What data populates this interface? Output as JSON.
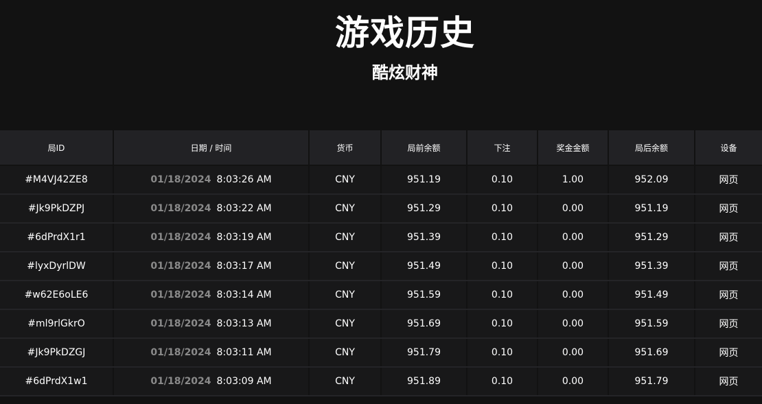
{
  "header": {
    "title": "游戏历史",
    "subtitle": "酷炫财神"
  },
  "table": {
    "columns": [
      "局ID",
      "日期 / 时间",
      "货币",
      "局前余额",
      "下注",
      "奖金金额",
      "局后余额",
      "设备"
    ],
    "rows": [
      {
        "id": "#M4VJ42ZE8",
        "date": "01/18/2024",
        "time": "8:03:26 AM",
        "currency": "CNY",
        "before": "951.19",
        "bet": "0.10",
        "win": "1.00",
        "after": "952.09",
        "device": "网页"
      },
      {
        "id": "#Jk9PkDZPJ",
        "date": "01/18/2024",
        "time": "8:03:22 AM",
        "currency": "CNY",
        "before": "951.29",
        "bet": "0.10",
        "win": "0.00",
        "after": "951.19",
        "device": "网页"
      },
      {
        "id": "#6dPrdX1r1",
        "date": "01/18/2024",
        "time": "8:03:19 AM",
        "currency": "CNY",
        "before": "951.39",
        "bet": "0.10",
        "win": "0.00",
        "after": "951.29",
        "device": "网页"
      },
      {
        "id": "#lyxDyrlDW",
        "date": "01/18/2024",
        "time": "8:03:17 AM",
        "currency": "CNY",
        "before": "951.49",
        "bet": "0.10",
        "win": "0.00",
        "after": "951.39",
        "device": "网页"
      },
      {
        "id": "#w62E6oLE6",
        "date": "01/18/2024",
        "time": "8:03:14 AM",
        "currency": "CNY",
        "before": "951.59",
        "bet": "0.10",
        "win": "0.00",
        "after": "951.49",
        "device": "网页"
      },
      {
        "id": "#ml9rlGkrO",
        "date": "01/18/2024",
        "time": "8:03:13 AM",
        "currency": "CNY",
        "before": "951.69",
        "bet": "0.10",
        "win": "0.00",
        "after": "951.59",
        "device": "网页"
      },
      {
        "id": "#Jk9PkDZGJ",
        "date": "01/18/2024",
        "time": "8:03:11 AM",
        "currency": "CNY",
        "before": "951.79",
        "bet": "0.10",
        "win": "0.00",
        "after": "951.69",
        "device": "网页"
      },
      {
        "id": "#6dPrdX1w1",
        "date": "01/18/2024",
        "time": "8:03:09 AM",
        "currency": "CNY",
        "before": "951.89",
        "bet": "0.10",
        "win": "0.00",
        "after": "951.79",
        "device": "网页"
      }
    ]
  }
}
